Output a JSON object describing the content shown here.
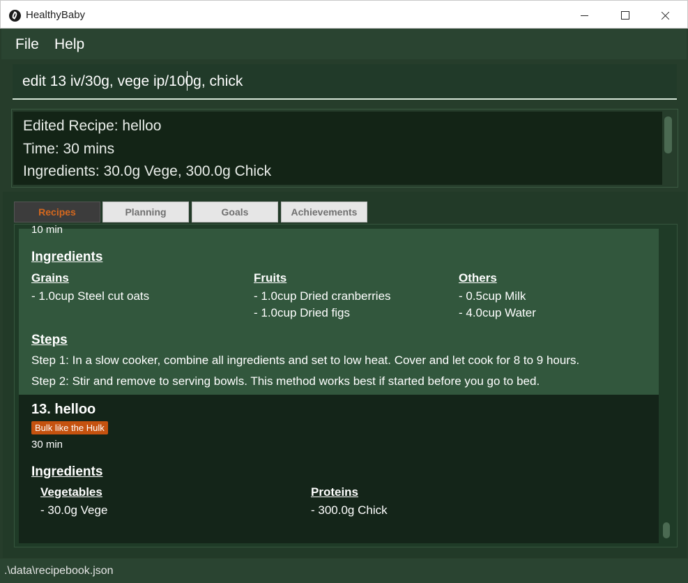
{
  "window": {
    "title": "HealthyBaby"
  },
  "menu": {
    "file": "File",
    "help": "Help"
  },
  "command": {
    "value": "edit 13 iv/30g, vege ip/100g, chick"
  },
  "result": {
    "lines": [
      "Edited Recipe: helloo",
      "Time: 30 mins",
      "Ingredients: 30.0g Vege, 300.0g Chick"
    ]
  },
  "tabs": [
    "Recipes",
    "Planning",
    "Goals",
    "Achievements"
  ],
  "recipe_prev": {
    "time": "10 min",
    "ingredients_heading": "Ingredients",
    "groups": [
      {
        "name": "Grains",
        "items": [
          "- 1.0cup Steel cut oats"
        ]
      },
      {
        "name": "Fruits",
        "items": [
          "- 1.0cup Dried cranberries",
          "- 1.0cup Dried figs"
        ]
      },
      {
        "name": "Others",
        "items": [
          "- 0.5cup Milk",
          "- 4.0cup Water"
        ]
      }
    ],
    "steps_heading": "Steps",
    "steps": [
      "Step 1: In a slow cooker, combine all ingredients and set to low heat. Cover and let cook for 8 to 9 hours.",
      "Step 2: Stir and remove to serving bowls. This method works best if started before you go to bed."
    ]
  },
  "recipe_13": {
    "title": "13.  helloo",
    "badge": "Bulk like the Hulk",
    "time": "30 min",
    "ingredients_heading": "Ingredients",
    "groups": [
      {
        "name": "Vegetables",
        "items": [
          "- 30.0g Vege"
        ]
      },
      {
        "name": "Proteins",
        "items": [
          "- 300.0g Chick"
        ]
      }
    ]
  },
  "status": {
    "path": ".\\data\\recipebook.json"
  }
}
